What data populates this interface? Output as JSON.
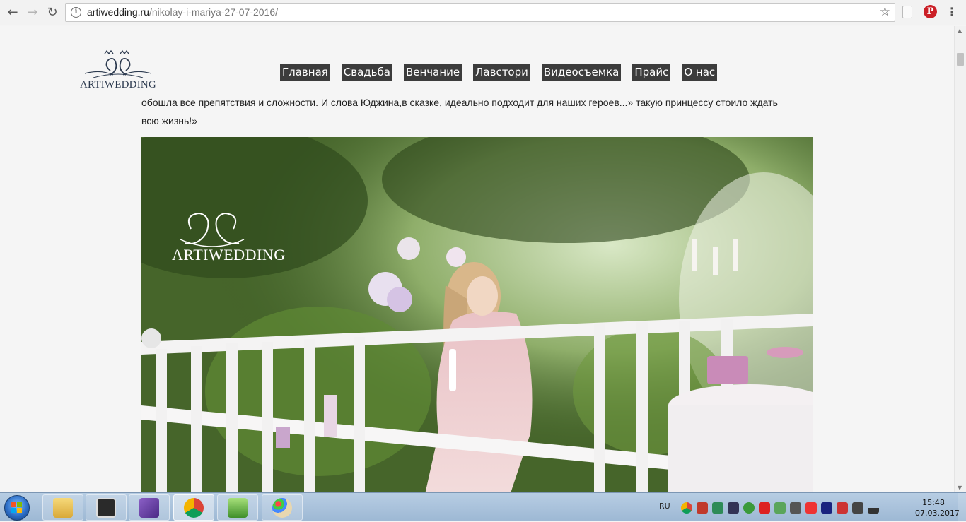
{
  "browser": {
    "url_host": "artiwedding.ru",
    "url_path": "/nikolay-i-mariya-27-07-2016/"
  },
  "site": {
    "logo_text": "ARTIWEDDING",
    "menu": [
      {
        "label": "Главная"
      },
      {
        "label": "Свадьба"
      },
      {
        "label": "Венчание"
      },
      {
        "label": "Лавстори"
      },
      {
        "label": "Видеосъемка"
      },
      {
        "label": "Прайс"
      },
      {
        "label": "О нас"
      }
    ],
    "paragraph_line1": "обошла все препятствия и сложности. И слова Юджина,в сказке, идеально подходит для наших героев...» такую принцессу стоило ждать",
    "paragraph_line2": "всю жизнь!»",
    "photo_watermark": "ARTIWEDDING"
  },
  "taskbar": {
    "language": "RU",
    "time": "15:48",
    "date": "07.03.2017",
    "pinned": [
      {
        "name": "explorer"
      },
      {
        "name": "media-player-classic"
      },
      {
        "name": "visual-studio"
      },
      {
        "name": "chrome"
      },
      {
        "name": "notepad-plus"
      },
      {
        "name": "paint"
      }
    ]
  },
  "colors": {
    "menu_bg": "#3c3c3c",
    "pinterest": "#cb2027"
  }
}
